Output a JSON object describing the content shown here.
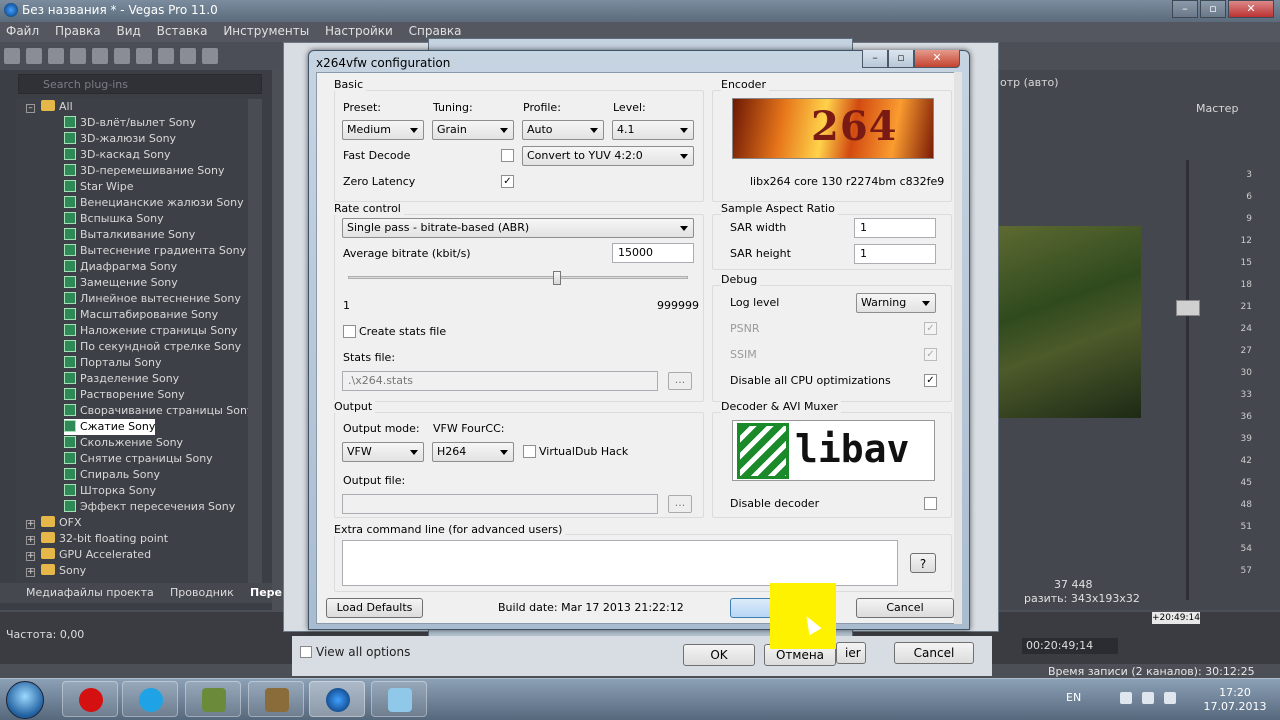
{
  "app": {
    "title": "Без названия * - Vegas Pro 11.0"
  },
  "menu": [
    "Файл",
    "Правка",
    "Вид",
    "Вставка",
    "Инструменты",
    "Настройки",
    "Справка"
  ],
  "left_panel": {
    "search_placeholder": "Search plug-ins",
    "tree_root": "All",
    "plugins": [
      "3D-влёт/вылет Sony",
      "3D-жалюзи Sony",
      "3D-каскад Sony",
      "3D-перемешивание Sony",
      "Star Wipe",
      "Венецианские жалюзи Sony",
      "Вспышка Sony",
      "Выталкивание Sony",
      "Вытеснение градиента Sony",
      "Диафрагма Sony",
      "Замещение Sony",
      "Линейное вытеснение Sony",
      "Масштабирование Sony",
      "Наложение страницы Sony",
      "По секундной стрелке Sony",
      "Порталы Sony",
      "Разделение Sony",
      "Растворение Sony",
      "Сворачивание страницы Sony",
      "Сжатие Sony",
      "Скольжение Sony",
      "Снятие страницы Sony",
      "Спираль Sony",
      "Шторка Sony",
      "Эффект пересечения Sony"
    ],
    "selected_plugin": "Сжатие Sony",
    "folders": [
      "OFX",
      "32-bit floating point",
      "GPU Accelerated",
      "Sony"
    ],
    "tabs": [
      "Медиафайлы проекта",
      "Проводник",
      "Пере"
    ],
    "frequency": "Частота: 0,00"
  },
  "background_dialogs": {
    "view_all": "View all options",
    "ok": "OK",
    "cancel_ru": "Отмена",
    "cancel": "Cancel",
    "ier_fragment": "ier",
    "preview_label": "отр (авто)"
  },
  "right_panel": {
    "master": "Мастер",
    "meter_ticks": [
      "3",
      "6",
      "9",
      "12",
      "15",
      "18",
      "21",
      "24",
      "27",
      "30",
      "33",
      "36",
      "39",
      "42",
      "45",
      "48",
      "51",
      "54",
      "57"
    ],
    "stat1": "37 448",
    "stat2_label": "разить:",
    "stat2_value": "343x193x32",
    "timecode": "+20:49:14",
    "rec_time": "00:20:49;14",
    "rec_channels": "Время записи (2 каналов): 30:12:25"
  },
  "dialog": {
    "title": "x264vfw configuration",
    "basic": {
      "label": "Basic",
      "preset_label": "Preset:",
      "preset": "Medium",
      "tuning_label": "Tuning:",
      "tuning": "Grain",
      "profile_label": "Profile:",
      "profile": "Auto",
      "level_label": "Level:",
      "level": "4.1",
      "fast_decode": "Fast Decode",
      "zero_latency": "Zero Latency",
      "convert": "Convert to YUV 4:2:0"
    },
    "encoder": {
      "label": "Encoder",
      "logo_text": "264",
      "version": "libx264 core 130 r2274bm c832fe9"
    },
    "rate_control": {
      "label": "Rate control",
      "mode": "Single pass - bitrate-based (ABR)",
      "bitrate_label": "Average bitrate (kbit/s)",
      "bitrate": "15000",
      "min": "1",
      "max": "999999",
      "slider_value": 15000,
      "create_stats": "Create stats file",
      "stats_file_label": "Stats file:",
      "stats_file": ".\\x264.stats",
      "browse": "..."
    },
    "sar": {
      "label": "Sample Aspect Ratio",
      "width_label": "SAR width",
      "width": "1",
      "height_label": "SAR height",
      "height": "1"
    },
    "debug": {
      "label": "Debug",
      "log_level_label": "Log level",
      "log_level": "Warning",
      "psnr": "PSNR",
      "ssim": "SSIM",
      "disable_cpu": "Disable all CPU optimizations"
    },
    "output": {
      "label": "Output",
      "mode_label": "Output mode:",
      "mode": "VFW",
      "fourcc_label": "VFW FourCC:",
      "fourcc": "H264",
      "vdub_hack": "VirtualDub Hack",
      "file_label": "Output file:"
    },
    "decoder": {
      "label": "Decoder & AVI Muxer",
      "logo_text": "libav",
      "disable_decoder": "Disable decoder"
    },
    "extra": {
      "label": "Extra command line (for advanced users)",
      "help": "?"
    },
    "footer": {
      "load_defaults": "Load Defaults",
      "build_date": "Build date: Mar 17 2013 21:22:12",
      "cancel": "Cancel"
    },
    "checks": {
      "fast_decode": false,
      "zero_latency": true,
      "create_stats": false,
      "vdub_hack": false,
      "psnr": true,
      "ssim": true,
      "disable_cpu": true,
      "disable_decoder": false
    }
  },
  "taskbar": {
    "lang": "EN",
    "time": "17:20",
    "date": "17.07.2013"
  },
  "colors": {
    "accent_yellow": "#fff200",
    "encoder_logo_red": "#7a1a14",
    "libav_green": "#1a8a2a"
  }
}
